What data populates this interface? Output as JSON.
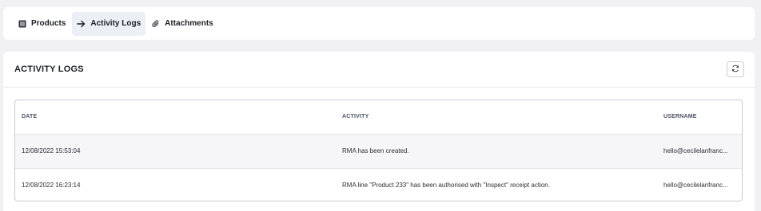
{
  "tabs": [
    {
      "label": "Products",
      "icon": "list-icon",
      "active": false
    },
    {
      "label": "Activity Logs",
      "icon": "arrow-right-icon",
      "active": true
    },
    {
      "label": "Attachments",
      "icon": "paperclip-icon",
      "active": false
    }
  ],
  "panel": {
    "title": "ACTIVITY LOGS",
    "refresh_icon": "refresh-icon"
  },
  "table": {
    "columns": [
      "DATE",
      "ACTIVITY",
      "USERNAME"
    ],
    "rows": [
      {
        "date": "12/08/2022 15:53:04",
        "activity": "RMA has been created.",
        "username": "hello@cecilelanfranc..."
      },
      {
        "date": "12/08/2022 16:23:14",
        "activity": "RMA line \"Product 233\" has been authorised with \"Inspect\" receipt action.",
        "username": "hello@cecilelanfranc..."
      }
    ]
  },
  "colors": {
    "active_tab_bg": "#ecf0f6",
    "page_bg": "#f1f1f4",
    "border": "#c9ccd3"
  }
}
